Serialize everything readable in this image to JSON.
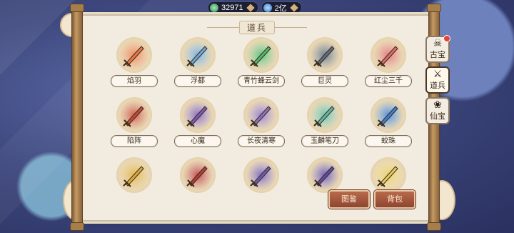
{
  "currency": {
    "jade_amount": "32971",
    "gem_amount": "2亿"
  },
  "panel": {
    "title": "道兵"
  },
  "items": [
    {
      "label": "焰羽",
      "color": "#e6784a"
    },
    {
      "label": "浮都",
      "color": "#6aa6d6"
    },
    {
      "label": "青竹蜂云剑",
      "color": "#4fb66f"
    },
    {
      "label": "巨灵",
      "color": "#5b6b7c"
    },
    {
      "label": "红尘三千",
      "color": "#d86b6b"
    },
    {
      "label": "陷阵",
      "color": "#c24a36"
    },
    {
      "label": "心魔",
      "color": "#7a5ab8"
    },
    {
      "label": "长夜清寒",
      "color": "#8b6fc0"
    },
    {
      "label": "玉麟笔刀",
      "color": "#5fb7a5"
    },
    {
      "label": "蛟珠",
      "color": "#3c7fd0"
    },
    {
      "label": "",
      "color": "#d9a93b"
    },
    {
      "label": "",
      "color": "#b43a3a"
    },
    {
      "label": "",
      "color": "#6f58b3"
    },
    {
      "label": "",
      "color": "#5b4aa8"
    },
    {
      "label": "",
      "color": "#e4c85a"
    }
  ],
  "side_tabs": [
    {
      "label": "古宝",
      "glyph": "☠",
      "has_notice": true
    },
    {
      "label": "道兵",
      "glyph": "⚔",
      "has_notice": false
    },
    {
      "label": "仙宝",
      "glyph": "❀",
      "has_notice": false
    }
  ],
  "buttons": {
    "atlas": "图鉴",
    "bag": "背包"
  }
}
